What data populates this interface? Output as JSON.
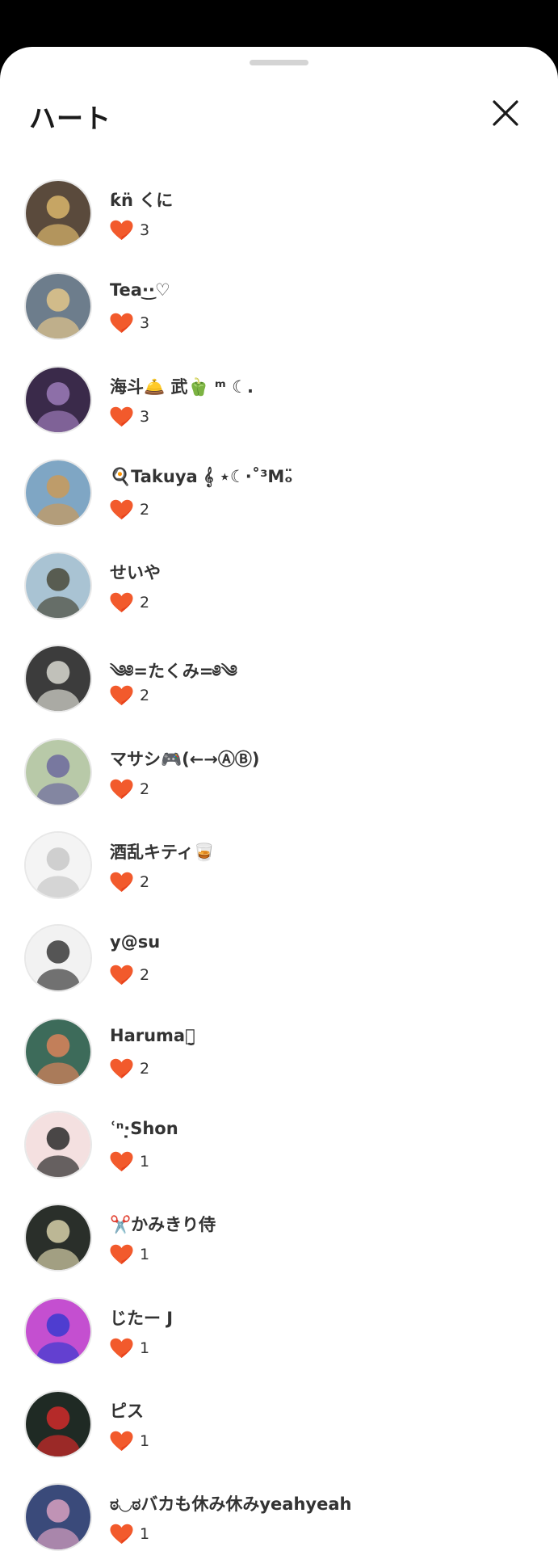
{
  "sheet": {
    "title": "ハート"
  },
  "colors": {
    "heart": "#f25a2c",
    "heart_shade": "#e8411b",
    "text": "#333333"
  },
  "users": [
    {
      "name": "ƙn̈ くに",
      "count": "3",
      "avatar_bg": "#5a4a3c",
      "avatar_fg": "#d9b56b"
    },
    {
      "name": "Tea·͜·♡",
      "count": "3",
      "avatar_bg": "#6d7d8c",
      "avatar_fg": "#e3c58a"
    },
    {
      "name": "海斗🛎️ 武🫑 ᵐ ☾.",
      "count": "3",
      "avatar_bg": "#3a2a4a",
      "avatar_fg": "#9c7bb8"
    },
    {
      "name": "🍳Takuya 𝄞 ⋆☾·˚³Mₒ̈",
      "count": "2",
      "avatar_bg": "#7fa6c4",
      "avatar_fg": "#c99a5b"
    },
    {
      "name": "せいや",
      "count": "2",
      "avatar_bg": "#a9c3d3",
      "avatar_fg": "#4a4a3a"
    },
    {
      "name": "༄༅=たくみ=༅༄",
      "count": "2",
      "avatar_bg": "#3c3c3c",
      "avatar_fg": "#d8d8d0"
    },
    {
      "name": "マサシ🎮(←→ⒶⒷ)",
      "count": "2",
      "avatar_bg": "#b8c9a8",
      "avatar_fg": "#6c6a9e"
    },
    {
      "name": "酒乱キティ🥃",
      "count": "2",
      "avatar_bg": "#f4f4f4",
      "avatar_fg": "#c8c8c8"
    },
    {
      "name": "y@su",
      "count": "2",
      "avatar_bg": "#f2f2f2",
      "avatar_fg": "#3a3a3a"
    },
    {
      "name": "Harumaꪔ̤̮",
      "count": "2",
      "avatar_bg": "#3d6b5a",
      "avatar_fg": "#d9825a"
    },
    {
      "name": "ʿⁿ·̣Shon",
      "count": "1",
      "avatar_bg": "#f4e0e0",
      "avatar_fg": "#2a2a2a"
    },
    {
      "name": "✂️かみきり侍",
      "count": "1",
      "avatar_bg": "#2a2f2a",
      "avatar_fg": "#d6cfa8"
    },
    {
      "name": "じたー J",
      "count": "1",
      "avatar_bg": "#c44fd0",
      "avatar_fg": "#3a3ad0"
    },
    {
      "name": "ピス",
      "count": "1",
      "avatar_bg": "#1f2a24",
      "avatar_fg": "#d02a2a"
    },
    {
      "name": "ಠ◡ಠバカも休み休みyeahyeah",
      "count": "1",
      "avatar_bg": "#3a4a7a",
      "avatar_fg": "#d8a0c0"
    }
  ]
}
